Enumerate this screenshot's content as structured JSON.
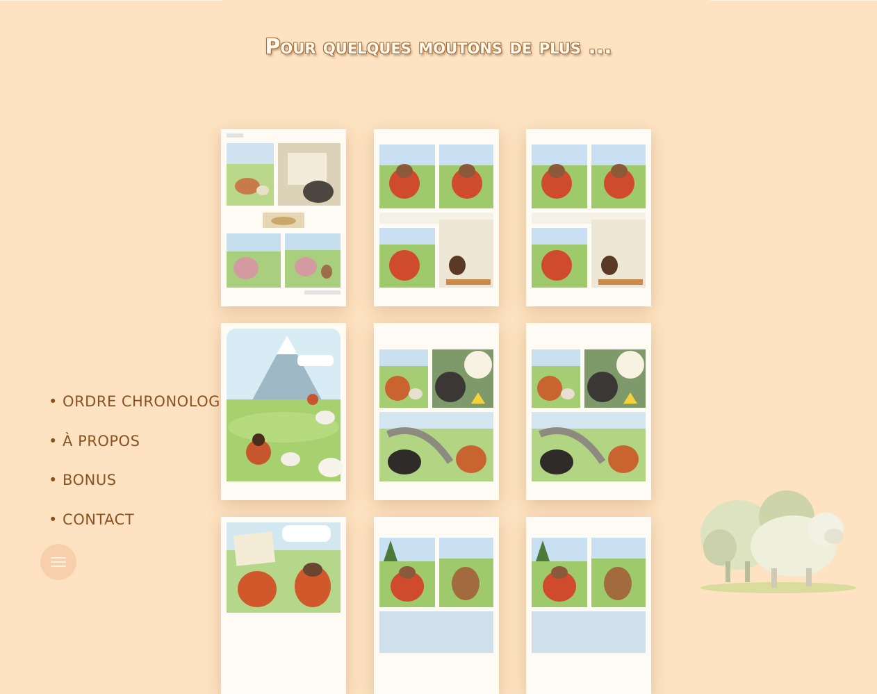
{
  "page": {
    "title": "Pour quelques moutons de plus ...",
    "background_color": "#fde3c2",
    "accent_color": "#8a5220"
  },
  "menu": {
    "items": [
      {
        "id": "chrono",
        "label": "• ORDRE CHRONOLOGIQUE"
      },
      {
        "id": "about",
        "label": "• À PROPOS"
      },
      {
        "id": "bonus",
        "label": "• BONUS"
      },
      {
        "id": "contact",
        "label": "• CONTACT"
      }
    ],
    "toggle_icon": "hamburger-icon"
  },
  "gallery": {
    "pages": [
      {
        "id": "page-1",
        "type": "two-panel-rows-1"
      },
      {
        "id": "page-2",
        "type": "four-panel"
      },
      {
        "id": "page-3",
        "type": "four-panel"
      },
      {
        "id": "page-4",
        "type": "splash"
      },
      {
        "id": "page-5",
        "type": "four-panel-dark"
      },
      {
        "id": "page-6",
        "type": "four-panel-dark"
      },
      {
        "id": "page-7",
        "type": "letter"
      },
      {
        "id": "page-8",
        "type": "four-panel-forest"
      },
      {
        "id": "page-9",
        "type": "four-panel-forest"
      }
    ]
  },
  "decoration": {
    "illustration": "sheep-illustration"
  }
}
